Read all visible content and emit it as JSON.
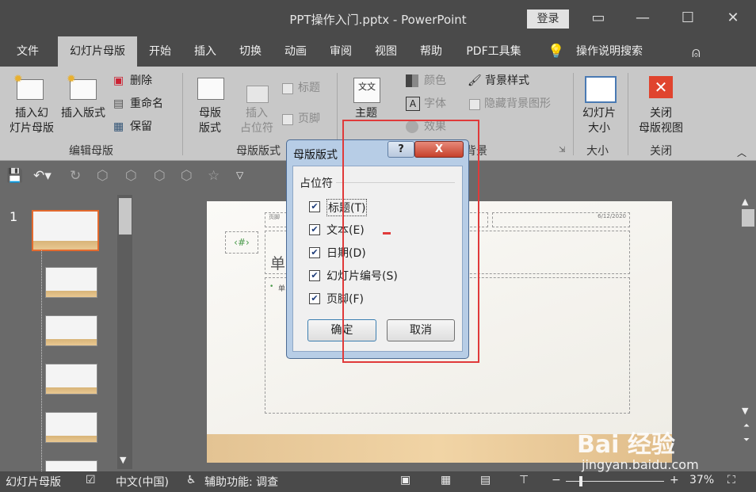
{
  "window": {
    "title": "PPT操作入门.pptx - PowerPoint",
    "login": "登录"
  },
  "tabs": [
    "文件",
    "幻灯片母版",
    "开始",
    "插入",
    "切换",
    "动画",
    "审阅",
    "视图",
    "帮助",
    "PDF工具集"
  ],
  "tell_me": "操作说明搜索",
  "ribbon": {
    "insert_master_1": "插入幻",
    "insert_master_2": "灯片母版",
    "insert_layout": "插入版式",
    "delete": "删除",
    "rename": "重命名",
    "preserve": "保留",
    "group_edit": "编辑母版",
    "master_layout_1": "母版",
    "master_layout_2": "版式",
    "insert_ph_1": "插入",
    "insert_ph_2": "占位符",
    "title_chk": "标题",
    "footer_chk": "页脚",
    "group_layout": "母版版式",
    "theme": "主题",
    "colors": "颜色",
    "fonts": "字体",
    "effects": "效果",
    "bg_styles": "背景样式",
    "hide_bg": "隐藏背景图形",
    "group_bg": "背景",
    "slide_size_1": "幻灯片",
    "slide_size_2": "大小",
    "group_size": "大小",
    "close_1": "关闭",
    "close_2": "母版视图",
    "group_close": "关闭"
  },
  "thumbs": {
    "first_num": "1"
  },
  "slide": {
    "header_text": "页脚",
    "date_text": "6/12/2020",
    "num_ph": "‹#›",
    "title_partial": "单",
    "bullet_partial": "单"
  },
  "dialog": {
    "title": "母版版式",
    "help": "?",
    "close": "X",
    "section": "占位符",
    "options": [
      {
        "label": "标题(T)",
        "checked": true
      },
      {
        "label": "文本(E)",
        "checked": true
      },
      {
        "label": "日期(D)",
        "checked": true
      },
      {
        "label": "幻灯片编号(S)",
        "checked": true
      },
      {
        "label": "页脚(F)",
        "checked": true
      }
    ],
    "ok": "确定",
    "cancel": "取消"
  },
  "status": {
    "view": "幻灯片母版",
    "language": "中文(中国)",
    "accessibility": "辅助功能: 调查",
    "zoom": "37%",
    "minus": "−",
    "plus": "+"
  },
  "watermark": {
    "logo": "Bai 经验",
    "url": "jingyan.baidu.com"
  },
  "colors": {
    "annotation": "#e03a3a",
    "ribbon_bg": "#c8c8c8",
    "titlebar_bg": "#4a4a4a",
    "close_red": "#e0442e"
  }
}
